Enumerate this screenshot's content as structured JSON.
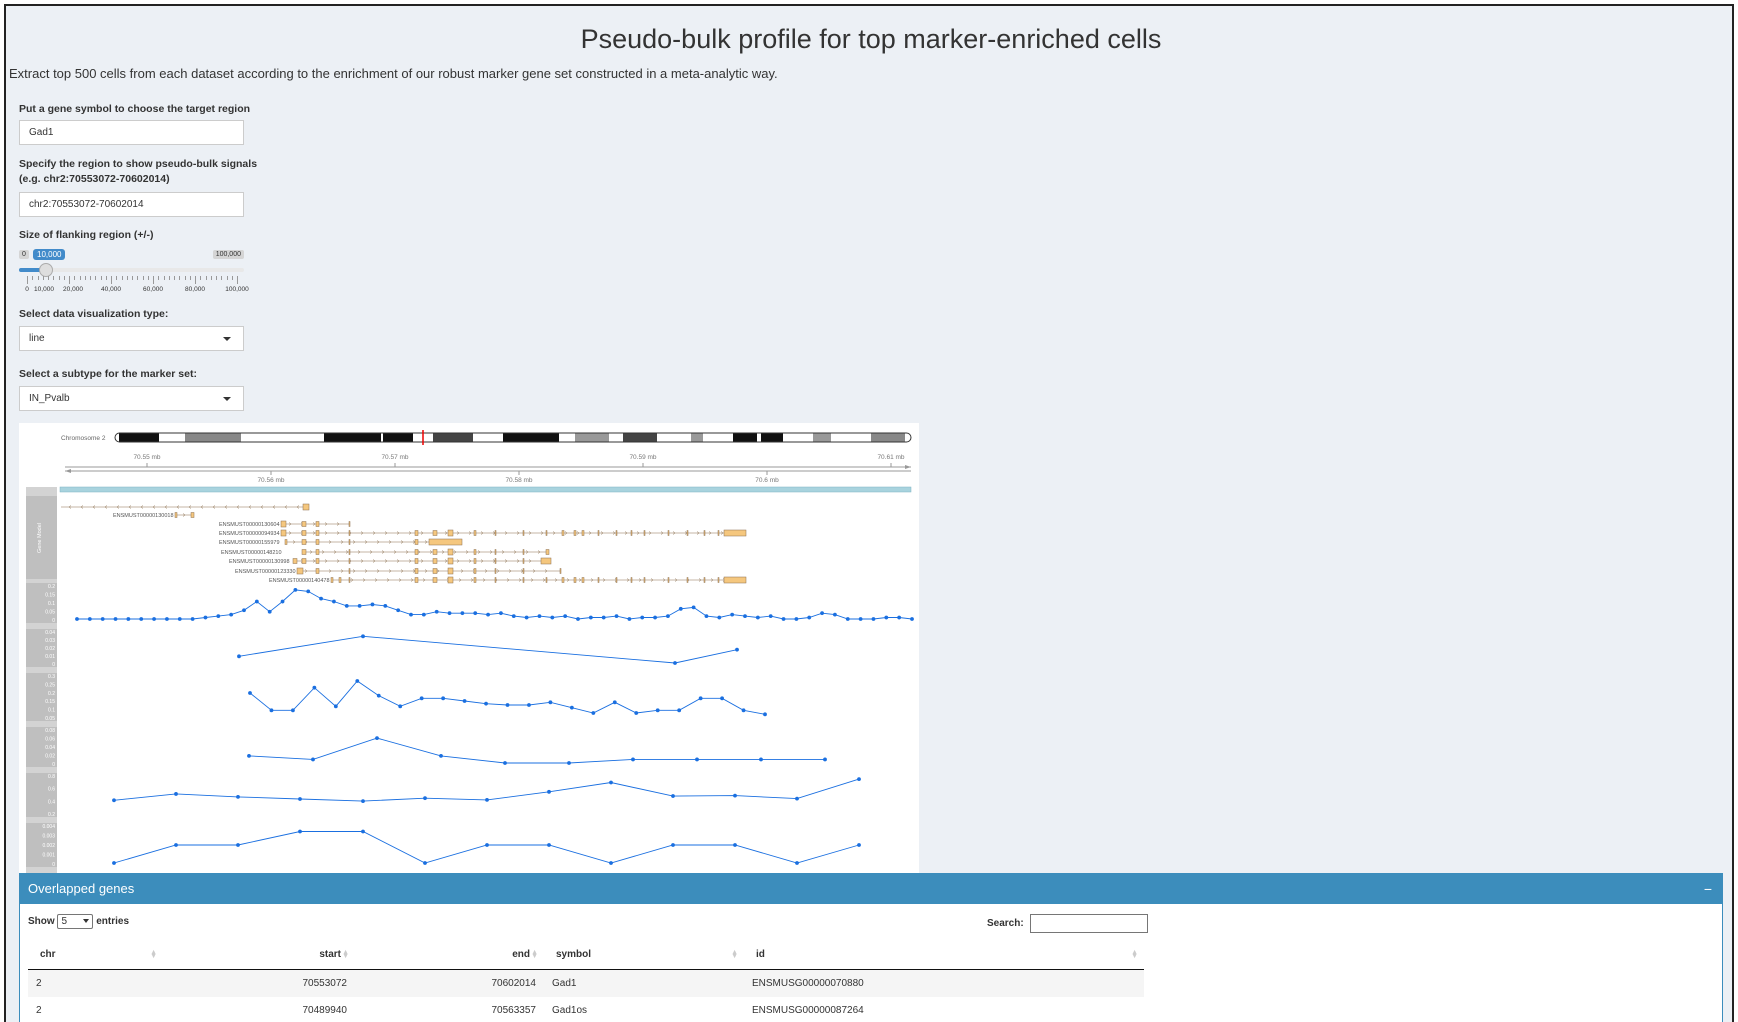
{
  "page": {
    "title": "Pseudo-bulk profile for top marker-enriched cells",
    "description": "Extract top 500 cells from each dataset according to the enrichment of our robust marker gene set constructed in a meta-analytic way."
  },
  "controls": {
    "gene_label": "Put a gene symbol to choose the target region",
    "gene_value": "Gad1",
    "region_label_line1": "Specify the region to show pseudo-bulk signals",
    "region_label_line2": "(e.g. chr2:70553072-70602014)",
    "region_value": "chr2:70553072-70602014",
    "flank_label": "Size of flanking region (+/-)",
    "flank_min": "0",
    "flank_max": "100,000",
    "flank_value": "10,000",
    "flank_value_fraction": 0.1,
    "flank_ticks": [
      "0",
      "10,000",
      "20,000",
      "40,000",
      "60,000",
      "80,000",
      "100,000"
    ],
    "vis_label": "Select data visualization type:",
    "vis_value": "line",
    "subtype_label": "Select a subtype for the marker set:",
    "subtype_value": "IN_Pvalb"
  },
  "tracks": {
    "chromosome_label": "Chromosome 2",
    "top_axis_ticks": [
      "70.55 mb",
      "70.57 mb",
      "70.59 mb",
      "70.61 mb"
    ],
    "bottom_axis_ticks": [
      "70.56 mb",
      "70.58 mb",
      "70.6 mb"
    ],
    "gene_model_label": "Gene Model",
    "transcripts": [
      "ENSMUST00000130018",
      "ENSMUST00000130604",
      "ENSMUST00000094934",
      "ENSMUST00000155979",
      "ENSMUST00000148210",
      "ENSMUST00000130998",
      "ENSMUST00000123330",
      "ENSMUST00000140478"
    ],
    "signal_tracks": [
      {
        "ticks": [
          "0.2",
          "0.15",
          "0.1",
          "0.05",
          "0"
        ],
        "values": [
          0.0,
          0.0,
          0.0,
          0.0,
          0.0,
          0.0,
          0.0,
          0.0,
          0.0,
          0.0,
          0.01,
          0.02,
          0.03,
          0.06,
          0.12,
          0.05,
          0.12,
          0.2,
          0.19,
          0.14,
          0.12,
          0.09,
          0.09,
          0.1,
          0.09,
          0.06,
          0.03,
          0.03,
          0.05,
          0.04,
          0.04,
          0.04,
          0.03,
          0.04,
          0.02,
          0.01,
          0.02,
          0.01,
          0.02,
          0.0,
          0.01,
          0.01,
          0.02,
          0.0,
          0.01,
          0.01,
          0.02,
          0.07,
          0.08,
          0.02,
          0.01,
          0.03,
          0.02,
          0.01,
          0.02,
          0.0,
          0.0,
          0.01,
          0.04,
          0.03,
          0.0,
          0.0,
          0.0,
          0.01,
          0.01,
          0.0
        ]
      },
      {
        "ticks": [
          "0.04",
          "0.03",
          "0.02",
          "0.01",
          "0"
        ],
        "values": [
          0.01,
          0.04,
          0.0,
          0.02
        ]
      },
      {
        "ticks": [
          "0.3",
          "0.25",
          "0.2",
          "0.15",
          "0.1",
          "0.05"
        ],
        "values": [
          0.18,
          0.05,
          0.05,
          0.22,
          0.08,
          0.27,
          0.16,
          0.08,
          0.14,
          0.14,
          0.12,
          0.1,
          0.09,
          0.09,
          0.11,
          0.07,
          0.03,
          0.11,
          0.03,
          0.05,
          0.05,
          0.14,
          0.14,
          0.05,
          0.02
        ]
      },
      {
        "ticks": [
          "0.08",
          "0.06",
          "0.04",
          "0.02",
          "0"
        ],
        "values": [
          0.02,
          0.01,
          0.07,
          0.02,
          0.0,
          0.0,
          0.01,
          0.01,
          0.01,
          0.01
        ]
      },
      {
        "ticks": [
          "0.8",
          "0.6",
          "0.4",
          "0.2"
        ],
        "values": [
          0.3,
          0.45,
          0.38,
          0.33,
          0.28,
          0.35,
          0.31,
          0.5,
          0.72,
          0.4,
          0.41,
          0.34,
          0.8
        ]
      },
      {
        "ticks": [
          "0.004",
          "0.003",
          "0.002",
          "0.001",
          "0"
        ],
        "values": [
          0.0,
          0.002,
          0.002,
          0.0035,
          0.0035,
          0.0,
          0.002,
          0.002,
          0.0,
          0.002,
          0.002,
          0.0,
          0.002
        ]
      }
    ]
  },
  "genes_box": {
    "title": "Overlapped genes",
    "collapse_label": "−",
    "show_label": "Show",
    "entries_value": "5",
    "entries_label": "entries",
    "search_label": "Search:",
    "columns": [
      "chr",
      "start",
      "end",
      "symbol",
      "id"
    ],
    "rows": [
      {
        "chr": "2",
        "start": "70553072",
        "end": "70602014",
        "symbol": "Gad1",
        "id": "ENSMUSG00000070880"
      },
      {
        "chr": "2",
        "start": "70489940",
        "end": "70563357",
        "symbol": "Gad1os",
        "id": "ENSMUSG00000087264"
      }
    ]
  },
  "colors": {
    "background": "#ecf0f5",
    "accent": "#3c8dbc",
    "slider": "#428bca",
    "signal": "#1a6fe0",
    "exon": "#f5c77e"
  }
}
